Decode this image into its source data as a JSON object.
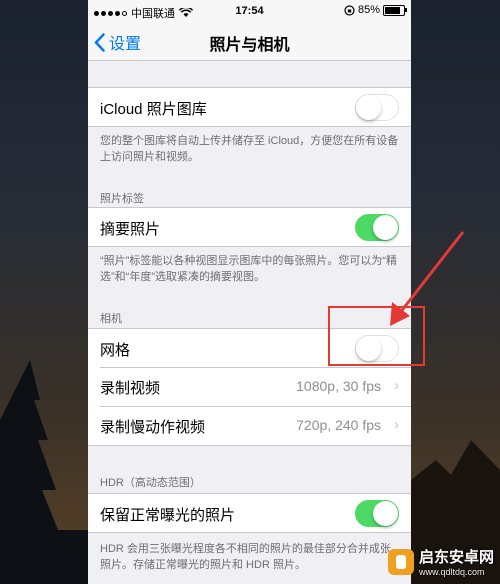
{
  "status": {
    "carrier": "中国联通",
    "time": "17:54",
    "battery_percent": "85%",
    "battery_level": 0.85,
    "icons": [
      "signal-dots-icon",
      "wifi-icon",
      "rotation-lock-icon",
      "battery-icon"
    ]
  },
  "nav": {
    "back_label": "设置",
    "title": "照片与相机"
  },
  "icloud": {
    "label": "iCloud 照片图库",
    "on": false,
    "footnote": "您的整个图库将自动上传并储存至 iCloud，方便您在所有设备上访问照片和视频。"
  },
  "photos_tab": {
    "header": "照片标签",
    "summary_label": "摘要照片",
    "summary_on": true,
    "footnote": "“照片”标签能以各种视图显示图库中的每张照片。您可以为“精选”和“年度”选取紧凑的摘要视图。"
  },
  "camera": {
    "header": "相机",
    "grid_label": "网格",
    "grid_on": false,
    "record_video_label": "录制视频",
    "record_video_value": "1080p, 30 fps",
    "slomo_label": "录制慢动作视频",
    "slomo_value": "720p, 240 fps"
  },
  "hdr": {
    "header": "HDR（高动态范围）",
    "keep_normal_label": "保留正常曝光的照片",
    "keep_normal_on": true,
    "footnote": "HDR 会用三张曝光程度各不相同的照片的最佳部分合并成张照片。存储正常曝光的照片和 HDR 照片。"
  },
  "annotation": {
    "color": "#e53935"
  },
  "watermark": {
    "title": "启东安卓网",
    "url": "www.qdltdq.com"
  },
  "colors": {
    "accent": "#007aff",
    "toggle_on": "#4cd964",
    "background": "#efeff4"
  }
}
